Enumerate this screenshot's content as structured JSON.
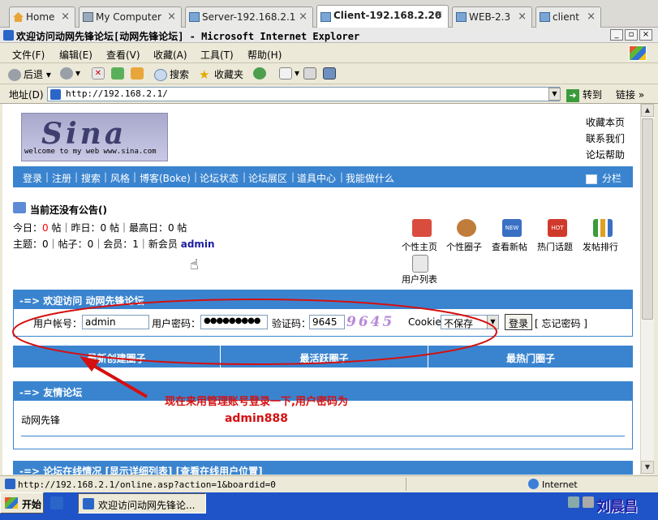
{
  "host_tabs": [
    {
      "label": "Home",
      "active": false
    },
    {
      "label": "My Computer",
      "active": false
    },
    {
      "label": "Server-192.168.2.1",
      "active": false
    },
    {
      "label": "Client-192.168.2.20",
      "active": true
    },
    {
      "label": "WEB-2.3",
      "active": false
    },
    {
      "label": "client",
      "active": false
    }
  ],
  "window": {
    "title": "欢迎访问动网先锋论坛[动网先锋论坛] - Microsoft Internet Explorer",
    "min": "_",
    "max": "▫",
    "close": "×"
  },
  "menu": [
    "文件(F)",
    "编辑(E)",
    "查看(V)",
    "收藏(A)",
    "工具(T)",
    "帮助(H)"
  ],
  "toolbar": {
    "back": "后退",
    "search": "搜索",
    "favorites": "收藏夹"
  },
  "address": {
    "label": "地址(D)",
    "url": "http://192.168.2.1/",
    "go": "转到",
    "links": "链接"
  },
  "page": {
    "logo": {
      "big": "Sina",
      "small": "welcome to my web www.sina.com"
    },
    "right_links": [
      "收藏本页",
      "联系我们",
      "论坛帮助"
    ],
    "nav": [
      "登录",
      "注册",
      "搜索",
      "风格",
      "博客(Boke)",
      "论坛状态",
      "论坛展区",
      "道具中心",
      "我能做什么"
    ],
    "nav_right": "分栏",
    "announcement": "当前还没有公告()",
    "stats1": {
      "today_label": "今日：",
      "today": "0",
      "unit": "帖",
      "yesterday": "昨日：0 帖",
      "max": "最高日：0 帖"
    },
    "stats2": {
      "text": "主题：0｜帖子：0｜会员：1｜新会员",
      "new_member": "admin"
    },
    "feature_icons": [
      "个性主页",
      "个性圈子",
      "查看新帖",
      "热门话题",
      "发帖排行",
      "用户列表"
    ],
    "login": {
      "header": "-=> 欢迎访问 动网先锋论坛",
      "user_label": "用户帐号：",
      "user_value": "admin",
      "pass_label": "用户密码：",
      "pass_value": "●●●●●●●●●",
      "code_label": "验证码：",
      "code_value": "9645",
      "captcha": "9645",
      "cookie_label": "Cookie",
      "cookie_value": "不保存",
      "submit": "登录",
      "forgot": "[ 忘记密码 ]"
    },
    "circle_tabs": [
      "最新创建圈子",
      "最活跃圈子",
      "最热门圈子"
    ],
    "friend": {
      "header": "-=> 友情论坛",
      "item": "动网先锋"
    },
    "online_header": "-=> 论坛在线情况 [显示详细列表] [查看在线用户位置]",
    "annotation": [
      "现在来用管理账号登录一下,用户密码为",
      "admin888"
    ]
  },
  "status": {
    "url": "http://192.168.2.1/online.asp?action=1&boardid=0",
    "zone": "Internet"
  },
  "taskbar": {
    "start": "开始",
    "item": "欢迎访问动网先锋论...",
    "watermark": "刘晨昌"
  },
  "colors": {
    "nav_blue": "#3a84cf",
    "annotation_red": "#d41010",
    "taskbar": "#1f53c8"
  }
}
